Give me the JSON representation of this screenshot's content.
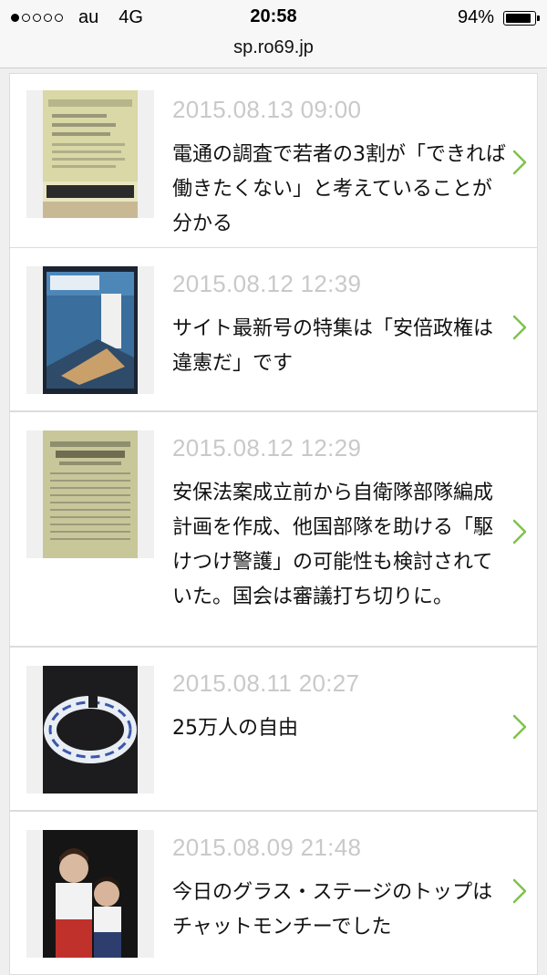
{
  "status_bar": {
    "carrier": "au",
    "network": "4G",
    "time": "20:58",
    "battery_label": "94%",
    "battery_level": 0.94,
    "signal_dots_filled": 1
  },
  "url_bar": {
    "domain": "sp.ro69.jp"
  },
  "colors": {
    "chevron": "#7fc34a",
    "date": "#c9c9c9"
  },
  "articles": [
    {
      "date": "2015.08.13 09:00",
      "title": "電通の調査で若者の3割が「できれば働きたくない」と考えていることが分かる"
    },
    {
      "date": "2015.08.12 12:39",
      "title": "サイト最新号の特集は「安倍政権は違憲だ」です"
    },
    {
      "date": "2015.08.12 12:29",
      "title": "安保法案成立前から自衛隊部隊編成計画を作成、他国部隊を助ける「駆けつけ警護」の可能性も検討されていた。国会は審議打ち切りに。"
    },
    {
      "date": "2015.08.11 20:27",
      "title": "25万人の自由"
    },
    {
      "date": "2015.08.09 21:48",
      "title": "今日のグラス・ステージのトップはチャットモンチーでした"
    }
  ]
}
